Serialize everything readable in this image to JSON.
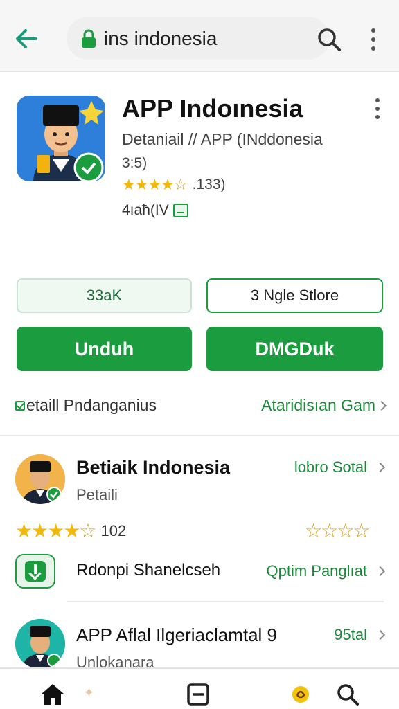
{
  "topbar": {
    "url_text": "ins indonesia"
  },
  "app": {
    "title": "APP Indoınesia",
    "subtitle": "Detaniail // APP (INddonesia",
    "score": "3:5)",
    "rating_count": ".133)",
    "age": "4ıaħ(IV",
    "rating_stars": 4
  },
  "buttons": {
    "outline_left": "33aK",
    "outline_right": "3 Ngle Stlore",
    "solid_left": "Unduh",
    "solid_right": "DMGDuk"
  },
  "detail": {
    "left": "etaill Pndanganius",
    "right": "Ataridisıan Gam"
  },
  "list": {
    "item1": {
      "title": "Betiaik Indonesia",
      "sub": "Petaili",
      "link": "lobro Sotal"
    },
    "rating2": {
      "count": "102",
      "stars": 4,
      "outline_stars": 4
    },
    "item2": {
      "title": "Rdonpi Shanelcseh",
      "link": "Qptim Panglıat"
    },
    "item3": {
      "title": "APP Aflal Ilgeriaclamtal 9",
      "sub": "Unlokanara",
      "link": "95tal"
    }
  },
  "colors": {
    "accent_green": "#1a9c3f",
    "star_gold": "#f2b90c"
  },
  "icons": [
    "back-arrow-icon",
    "lock-icon",
    "search-icon",
    "more-vert-icon",
    "home-icon",
    "tabs-icon",
    "badge-icon"
  ]
}
